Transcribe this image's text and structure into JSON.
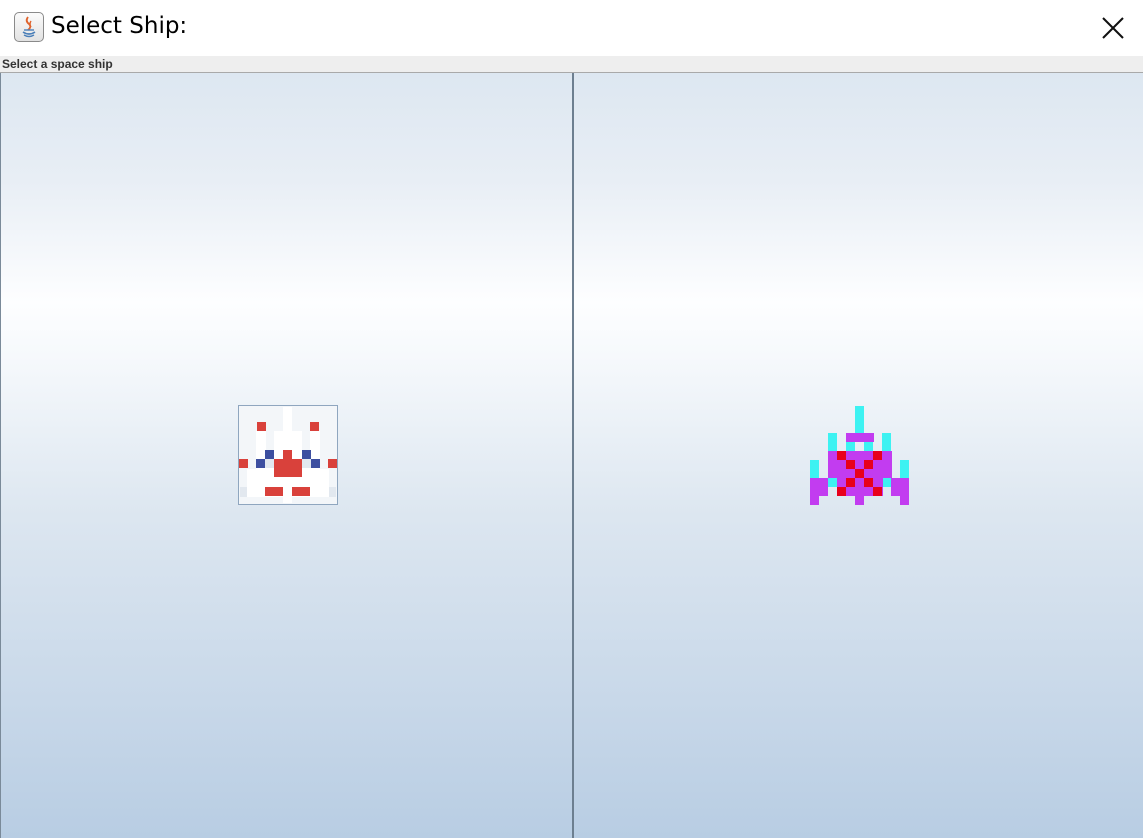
{
  "window": {
    "title": "Select Ship:",
    "app_icon": "java-icon",
    "close_icon": "close-icon"
  },
  "header": {
    "label": "Select a space ship"
  },
  "ships": [
    {
      "name": "white-red-fighter",
      "icon": "white-red-spaceship-icon",
      "colors": [
        "#ffffff",
        "#d9413b",
        "#3d4fa0",
        "#e2e8ef"
      ]
    },
    {
      "name": "purple-cyan-fighter",
      "icon": "purple-cyan-spaceship-icon",
      "colors": [
        "#c23cf0",
        "#e8001c",
        "#3df2f2"
      ]
    }
  ]
}
